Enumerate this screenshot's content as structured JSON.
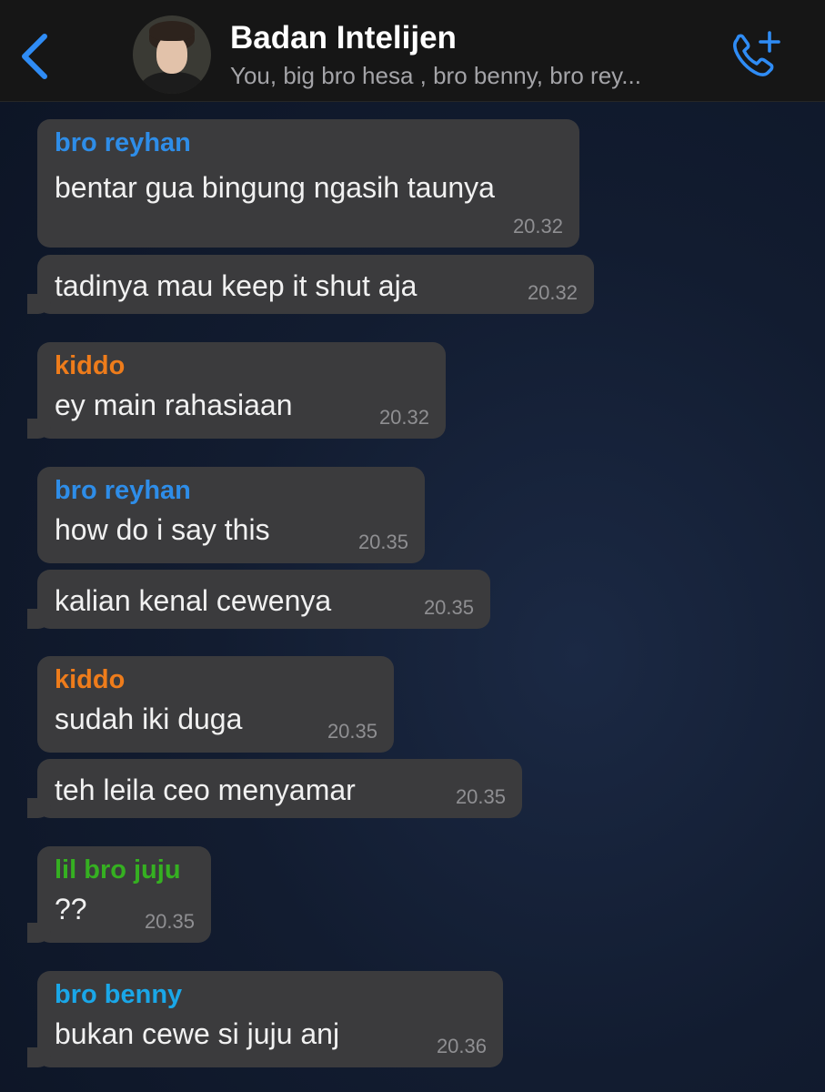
{
  "header": {
    "back_icon": "chevron-left-icon",
    "title": "Badan Intelijen",
    "subtitle": "You, big bro hesa , bro benny, bro rey...",
    "call_icon": "phone-plus-icon",
    "accent_color": "#2f8cf5"
  },
  "colors": {
    "bro_reyhan": "#2e8de8",
    "kiddo": "#ee7c1b",
    "lil_bro_juju": "#35b021",
    "bro_benny": "#1aa7e8"
  },
  "messages": [
    {
      "sender": "bro reyhan",
      "text": "bentar gua bingung ngasih taunya",
      "time": "20.32"
    },
    {
      "sender": "",
      "text": "tadinya mau keep it shut aja",
      "time": "20.32"
    },
    {
      "sender": "kiddo",
      "text": "ey main rahasiaan",
      "time": "20.32"
    },
    {
      "sender": "bro reyhan",
      "text": "how do i say this",
      "time": "20.35"
    },
    {
      "sender": "",
      "text": "kalian kenal cewenya",
      "time": "20.35"
    },
    {
      "sender": "kiddo",
      "text": "sudah iki duga",
      "time": "20.35"
    },
    {
      "sender": "",
      "text": "teh leila ceo menyamar",
      "time": "20.35"
    },
    {
      "sender": "lil bro juju",
      "text": "??",
      "time": "20.35"
    },
    {
      "sender": "bro benny",
      "text": "bukan cewe si juju anj",
      "time": "20.36"
    }
  ]
}
